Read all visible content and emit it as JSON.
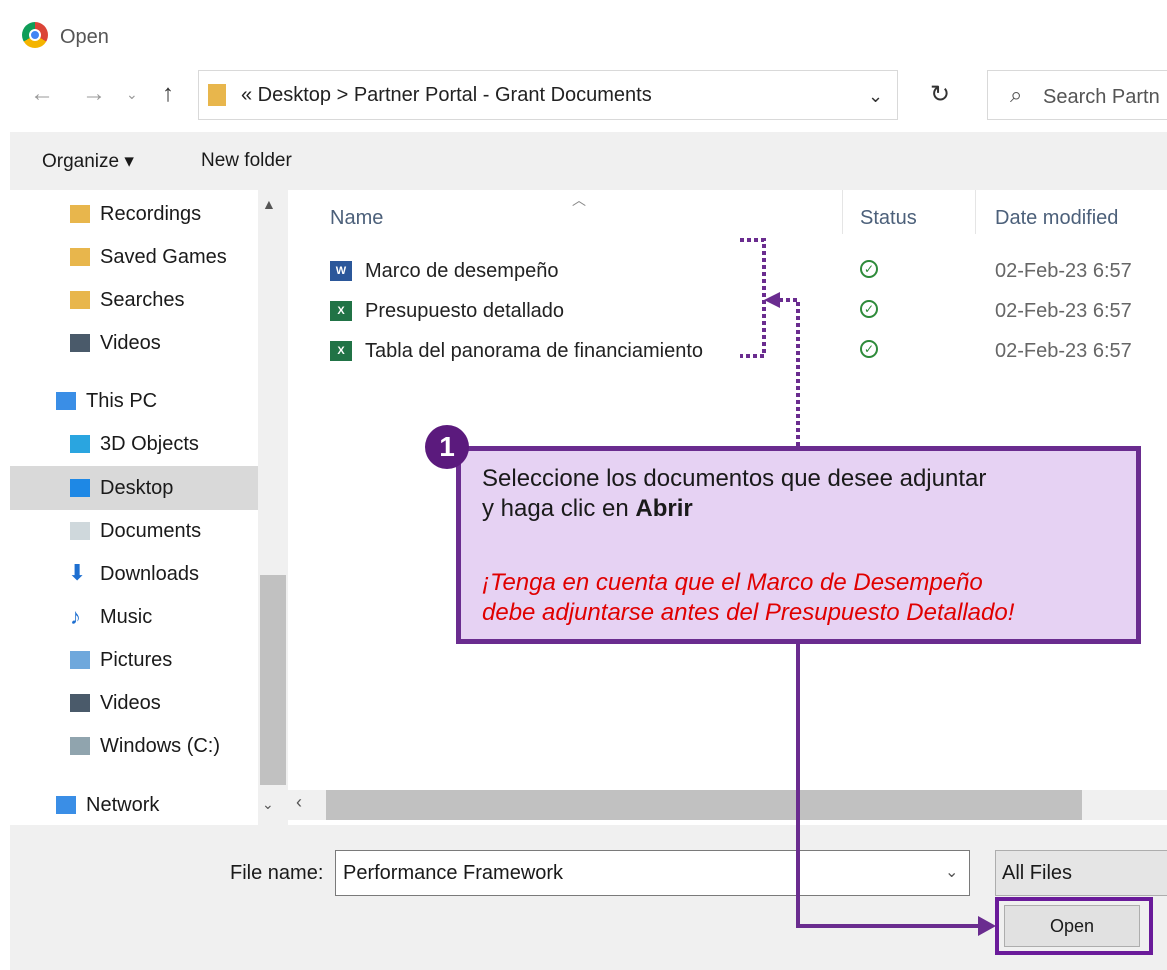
{
  "window": {
    "title": "Open"
  },
  "address": {
    "path": "«  Desktop  >  Partner Portal - Grant Documents",
    "search_placeholder": "Search Partn"
  },
  "toolbar": {
    "organize_label": "Organize ▾",
    "newfolder_label": "New folder"
  },
  "nav": {
    "items": [
      "Recordings",
      "Saved Games",
      "Searches",
      "Videos",
      "This PC",
      "3D Objects",
      "Desktop",
      "Documents",
      "Downloads",
      "Music",
      "Pictures",
      "Videos",
      "Windows (C:)",
      "Network"
    ],
    "selected": "Desktop"
  },
  "files": {
    "columns": {
      "name": "Name",
      "status": "Status",
      "date": "Date modified"
    },
    "rows": [
      {
        "name": "Marco de desempeño",
        "type": "word",
        "date": "02-Feb-23 6:57"
      },
      {
        "name": "Presupuesto detallado",
        "type": "excel",
        "date": "02-Feb-23 6:57"
      },
      {
        "name": "Tabla del panorama de financiamiento",
        "type": "excel",
        "date": "02-Feb-23 6:57"
      }
    ]
  },
  "bottom": {
    "filename_label": "File name:",
    "filename_value": "Performance Framework",
    "filetype": "All Files",
    "open_label": "Open"
  },
  "callout": {
    "number": "1",
    "line1": "Seleccione los documentos que desee adjuntar",
    "line2_prefix": "y haga clic en ",
    "line2_bold": "Abrir",
    "note1": "¡Tenga en cuenta que el Marco de Desempeño",
    "note2": "debe adjuntarse antes del Presupuesto Detallado!"
  },
  "colors": {
    "annotation": "#6a2c8f",
    "callout_bg": "#e6d2f3",
    "note": "#e00000"
  }
}
